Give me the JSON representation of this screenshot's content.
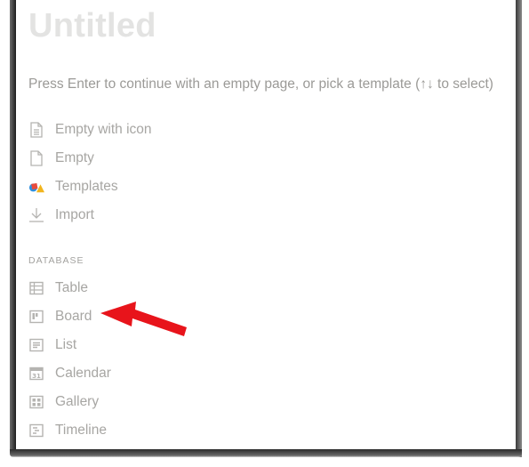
{
  "page": {
    "title": "Untitled",
    "hint": "Press Enter to continue with an empty page, or pick a template (↑↓ to select)"
  },
  "options": [
    {
      "label": "Empty with icon",
      "icon": "page-with-lines-icon"
    },
    {
      "label": "Empty",
      "icon": "blank-page-icon"
    },
    {
      "label": "Templates",
      "icon": "templates-shapes-icon"
    },
    {
      "label": "Import",
      "icon": "download-arrow-icon"
    }
  ],
  "database": {
    "section_label": "DATABASE",
    "items": [
      {
        "label": "Table",
        "icon": "table-icon"
      },
      {
        "label": "Board",
        "icon": "board-icon"
      },
      {
        "label": "List",
        "icon": "list-icon"
      },
      {
        "label": "Calendar",
        "icon": "calendar-icon",
        "icon_text": "31"
      },
      {
        "label": "Gallery",
        "icon": "gallery-icon"
      },
      {
        "label": "Timeline",
        "icon": "timeline-icon"
      }
    ]
  },
  "annotation": {
    "arrow_color": "#e8141b",
    "points_to": "Board"
  },
  "colors": {
    "title": "#e3e3e2",
    "muted_text": "#9b9a97",
    "icon_gray": "#b5b4b1"
  }
}
